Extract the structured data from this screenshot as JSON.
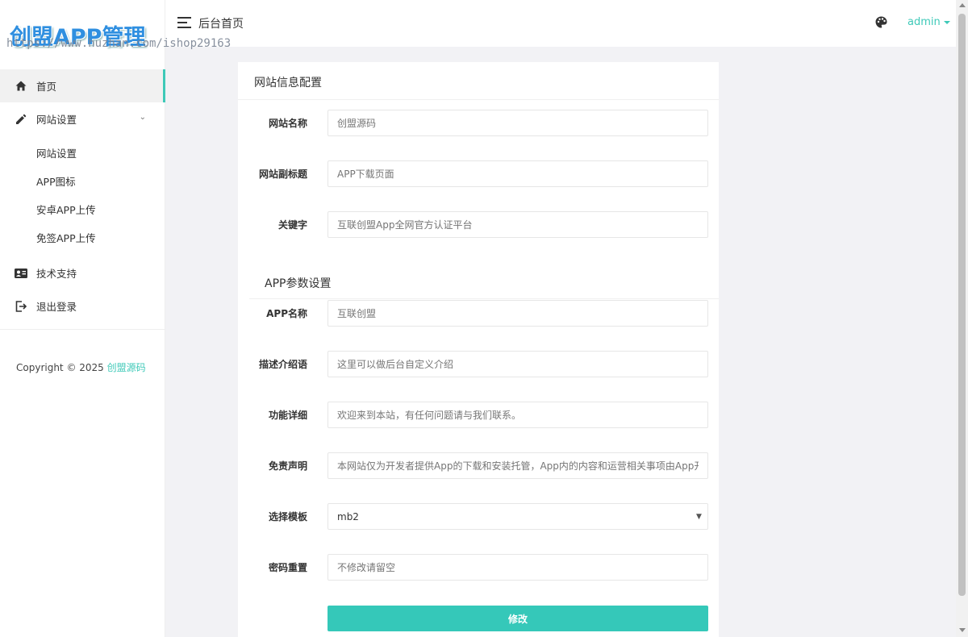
{
  "brand": {
    "logo_text": "创盟APP管理",
    "watermark": "https://www.huzhan.com/ishop29163"
  },
  "header": {
    "title": "后台首页",
    "user": "admin",
    "theme_icon": "palette-icon",
    "menu_icon": "hamburger-icon"
  },
  "sidebar": {
    "items": [
      {
        "label": "首页",
        "icon": "home-icon"
      },
      {
        "label": "网站设置",
        "icon": "pencil-icon"
      },
      {
        "label": "技术支持",
        "icon": "id-card-icon"
      },
      {
        "label": "退出登录",
        "icon": "logout-icon"
      }
    ],
    "sub_items": [
      {
        "label": "网站设置"
      },
      {
        "label": "APP图标"
      },
      {
        "label": "安卓APP上传"
      },
      {
        "label": "免签APP上传"
      }
    ],
    "copyright_prefix": "Copyright © 2025",
    "copyright_link": "创盟源码"
  },
  "form": {
    "title": "网站信息配置",
    "fields": [
      {
        "label": "网站名称",
        "placeholder": "创盟源码"
      },
      {
        "label": "网站副标题",
        "placeholder": "APP下载页面"
      },
      {
        "label": "关键字",
        "placeholder": "互联创盟App全网官方认证平台"
      }
    ],
    "app_section_title": "APP参数设置",
    "app_fields": [
      {
        "label": "APP名称",
        "placeholder": "互联创盟"
      },
      {
        "label": "描述介绍语",
        "placeholder": "这里可以做后台自定义介绍"
      },
      {
        "label": "功能详细",
        "placeholder": "欢迎来到本站，有任何问题请与我们联系。"
      },
      {
        "label": "免责声明",
        "placeholder": "本网站仅为开发者提供App的下载和安装托管，App内的内容和运营相关事项由App开"
      }
    ],
    "template": {
      "label": "选择模板",
      "value": "mb2"
    },
    "password": {
      "label": "密码重置",
      "placeholder": "不修改请留空"
    },
    "submit_label": "修改"
  },
  "colors": {
    "accent": "#35c8b9",
    "logo": "#2f8fe0",
    "background": "#f2f2f5"
  }
}
